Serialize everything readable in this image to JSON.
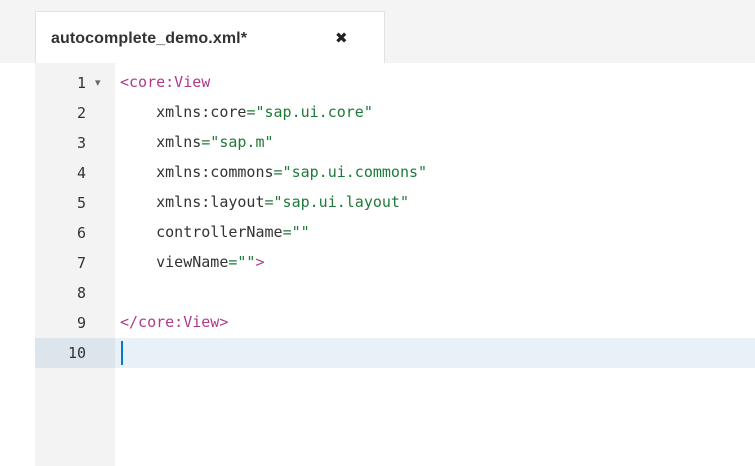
{
  "tab": {
    "title": "autocomplete_demo.xml*",
    "close_glyph": "✖"
  },
  "editor": {
    "fold_glyph": "▾",
    "lines": [
      {
        "num": "1",
        "code": "<core:View"
      },
      {
        "num": "2",
        "code": "    xmlns:core=\"sap.ui.core\""
      },
      {
        "num": "3",
        "code": "    xmlns=\"sap.m\""
      },
      {
        "num": "4",
        "code": "    xmlns:commons=\"sap.ui.commons\""
      },
      {
        "num": "5",
        "code": "    xmlns:layout=\"sap.ui.layout\""
      },
      {
        "num": "6",
        "code": "    controllerName=\"\""
      },
      {
        "num": "7",
        "code": "    viewName=\"\">"
      },
      {
        "num": "8",
        "code": ""
      },
      {
        "num": "9",
        "code": "</core:View>"
      },
      {
        "num": "10",
        "code": ""
      }
    ]
  },
  "colors": {
    "tag": "#b03a8a",
    "string": "#1f7a3a",
    "active_line": "#e9f1f8",
    "cursor": "#0078d4"
  }
}
